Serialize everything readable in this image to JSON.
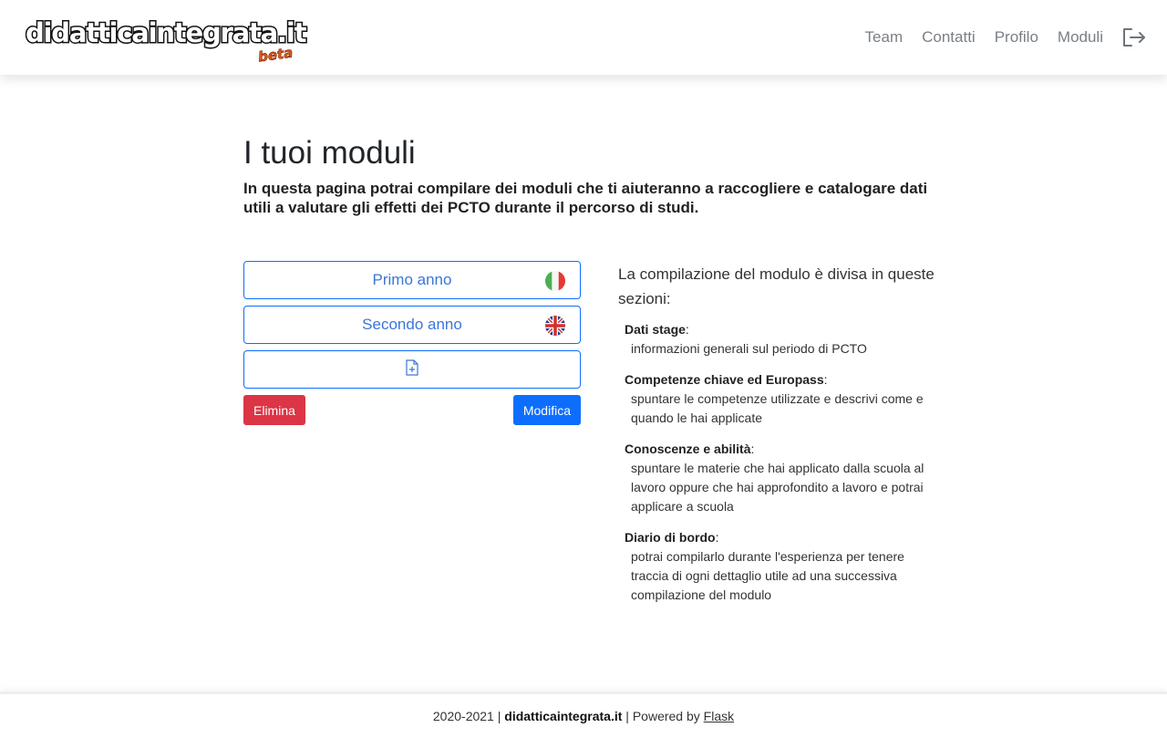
{
  "brand": {
    "name": "didatticaintegrata.it",
    "tag": "beta"
  },
  "nav": {
    "links": [
      "Team",
      "Contatti",
      "Profilo",
      "Moduli"
    ],
    "logout_icon": "logout-icon"
  },
  "page": {
    "title": "I tuoi moduli",
    "lead": "In questa pagina potrai compilare dei moduli che ti aiuteranno a raccogliere e catalogare dati utili a valutare gli effetti dei PCTO durante il percorso di studi."
  },
  "modules": [
    {
      "label": "Primo anno",
      "flag": "italy-flag-icon"
    },
    {
      "label": "Secondo anno",
      "flag": "uk-flag-icon"
    }
  ],
  "new_module_icon": "file-plus-icon",
  "actions": {
    "delete": "Elimina",
    "edit": "Modifica"
  },
  "info": {
    "intro": "La compilazione del modulo è divisa in queste sezioni:",
    "sections": [
      {
        "title": "Dati stage",
        "desc": "informazioni generali sul periodo di PCTO"
      },
      {
        "title": "Competenze chiave ed Europass",
        "desc": "spuntare le competenze utilizzate e descrivi come e quando le hai applicate"
      },
      {
        "title": "Conoscenze e abilità",
        "desc": "spuntare le materie che hai applicato dalla scuola al lavoro oppure che hai approfondito a lavoro e potrai applicare a scuola"
      },
      {
        "title": "Diario di bordo",
        "desc": "potrai compilarlo durante l'esperienza per tenere traccia di ogni dettaglio utile ad una successiva compilazione del modulo"
      }
    ]
  },
  "footer": {
    "years": "2020-2021",
    "site": "didatticaintegrata.it",
    "powered": "Powered by",
    "framework": "Flask"
  },
  "colors": {
    "primary": "#0d6efd",
    "danger": "#dc3545",
    "nav_text": "#7a7f85",
    "beta": "#d85a1b"
  }
}
